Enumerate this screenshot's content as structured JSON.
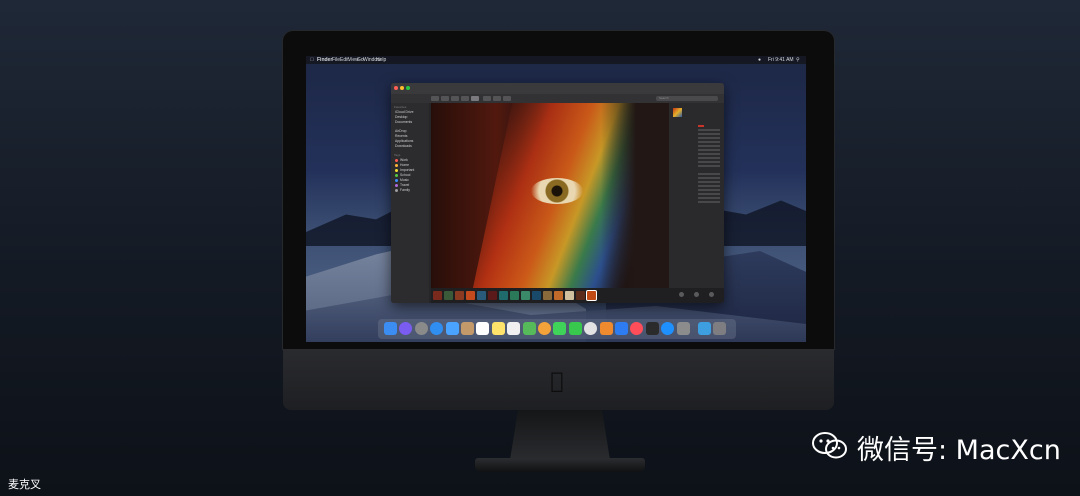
{
  "menubar": {
    "app_name": "Finder",
    "menus": [
      "File",
      "Edit",
      "View",
      "Go",
      "Window",
      "Help"
    ],
    "right_status": "Fri 9:41 AM"
  },
  "finder": {
    "sidebar": {
      "favorites_header": "Favorites",
      "favorites": [
        "iCloud Drive",
        "Desktop",
        "Documents",
        "AirDrop",
        "Recents",
        "Applications",
        "Downloads"
      ],
      "tags_header": "Tags",
      "tags": [
        {
          "label": "Work",
          "color": "#ff5a52"
        },
        {
          "label": "Home",
          "color": "#ffb43a"
        },
        {
          "label": "Important",
          "color": "#f5dd2e"
        },
        {
          "label": "School",
          "color": "#53c944"
        },
        {
          "label": "Music",
          "color": "#3c8dff"
        },
        {
          "label": "Travel",
          "color": "#b06adb"
        },
        {
          "label": "Family",
          "color": "#9c9ca0"
        }
      ]
    },
    "search_placeholder": "Search"
  },
  "dock": {
    "icons": [
      "finder-icon",
      "siri-icon",
      "launchpad-icon",
      "safari-icon",
      "mail-icon",
      "contacts-icon",
      "calendar-icon",
      "notes-icon",
      "reminders-icon",
      "maps-icon",
      "photos-icon",
      "messages-icon",
      "facetime-icon",
      "itunes-icon",
      "books-icon",
      "keynote-icon",
      "news-icon",
      "stocks-icon",
      "app-store-icon",
      "system-preferences-icon",
      "downloads-folder-icon",
      "trash-icon"
    ],
    "colors": [
      "#3b8df2",
      "#7a5cf0",
      "#8a8a8a",
      "#2f8ef0",
      "#4aa3ff",
      "#c49a6a",
      "#ffffff",
      "#ffe36a",
      "#f0f0f0",
      "#56b95a",
      "#f4a23a",
      "#3fd35a",
      "#39c84e",
      "#e3e3e3",
      "#f08a2e",
      "#2e7cf2",
      "#ff4d5a",
      "#2b2b2b",
      "#1e90ff",
      "#8c8c8c",
      "#3d9fe0",
      "#7e7e82"
    ]
  },
  "watermark": {
    "wechat_label": "微信号: MacXcn",
    "corner_label": "麦克叉"
  }
}
